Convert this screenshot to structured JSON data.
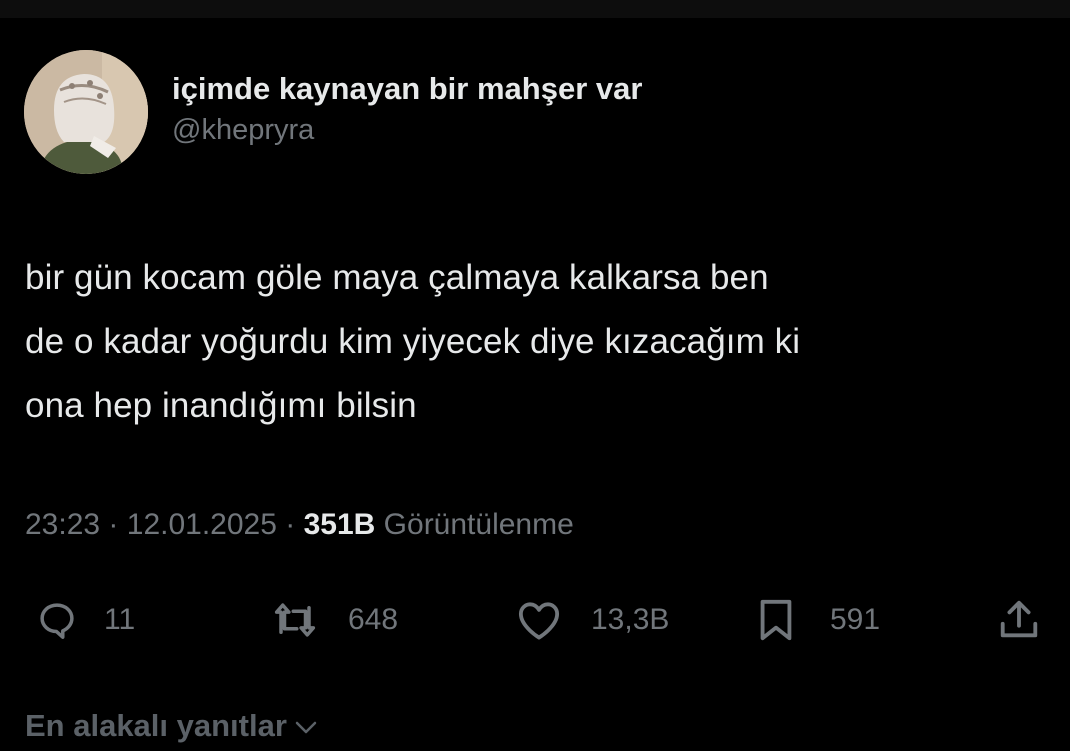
{
  "author": {
    "display_name": "içimde kaynayan bir mahşer var",
    "handle": "@khepryra"
  },
  "tweet": {
    "text_lines": [
      "bir gün kocam göle maya çalmaya kalkarsa ben",
      "de o kadar yoğurdu kim yiyecek diye kızacağım ki",
      "ona hep inandığımı bilsin"
    ]
  },
  "meta": {
    "time": "23:23",
    "separator": "·",
    "date": "12.01.2025",
    "views_count": "351B",
    "views_label": "Görüntülenme"
  },
  "actions": {
    "reply": {
      "icon": "reply-icon",
      "count": "11"
    },
    "retweet": {
      "icon": "retweet-icon",
      "count": "648"
    },
    "like": {
      "icon": "heart-icon",
      "count": "13,3B"
    },
    "bookmark": {
      "icon": "bookmark-icon",
      "count": "591"
    },
    "share": {
      "icon": "share-icon"
    }
  },
  "replies": {
    "sort_label": "En alakalı yanıtlar"
  },
  "colors": {
    "background": "#000000",
    "primary_text": "#e7e9ea",
    "secondary_text": "#71767b"
  }
}
